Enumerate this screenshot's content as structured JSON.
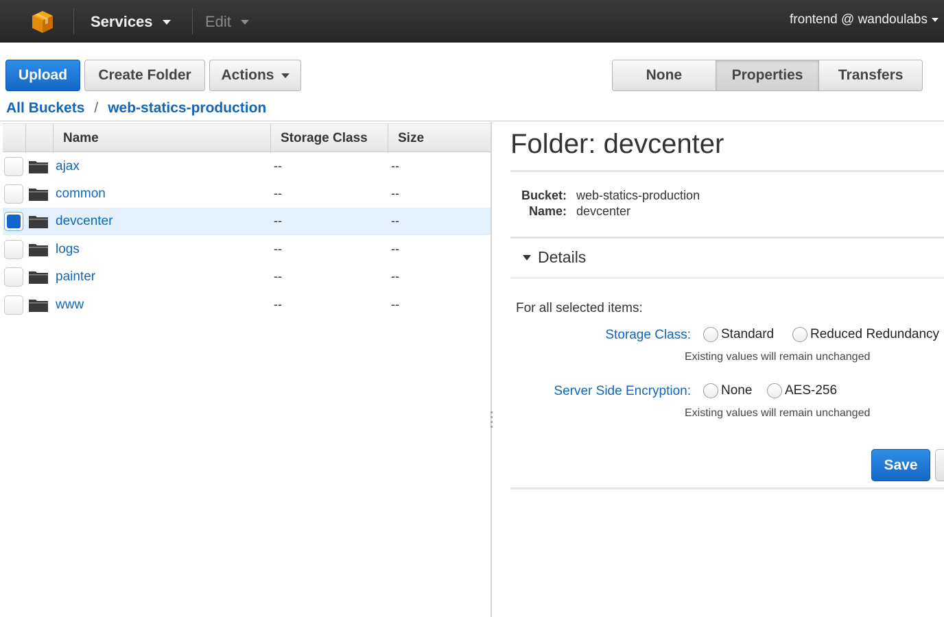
{
  "topbar": {
    "services_label": "Services",
    "edit_label": "Edit",
    "account_label": "frontend @ wandoulabs"
  },
  "toolbar": {
    "upload_label": "Upload",
    "create_folder_label": "Create Folder",
    "actions_label": "Actions",
    "view_tabs": [
      {
        "label": "None"
      },
      {
        "label": "Properties",
        "active": true
      },
      {
        "label": "Transfers"
      }
    ]
  },
  "breadcrumb": {
    "root": "All Buckets",
    "separator": "/",
    "bucket": "web-statics-production"
  },
  "table": {
    "columns": [
      "Name",
      "Storage Class",
      "Size"
    ],
    "rows": [
      {
        "name": "ajax",
        "storage_class": "--",
        "size": "--",
        "selected": false
      },
      {
        "name": "common",
        "storage_class": "--",
        "size": "--",
        "selected": false
      },
      {
        "name": "devcenter",
        "storage_class": "--",
        "size": "--",
        "selected": true
      },
      {
        "name": "logs",
        "storage_class": "--",
        "size": "--",
        "selected": false
      },
      {
        "name": "painter",
        "storage_class": "--",
        "size": "--",
        "selected": false
      },
      {
        "name": "www",
        "storage_class": "--",
        "size": "--",
        "selected": false
      }
    ]
  },
  "properties": {
    "title": "Folder: devcenter",
    "bucket_key": "Bucket:",
    "bucket_value": "web-statics-production",
    "name_key": "Name:",
    "name_value": "devcenter",
    "details_label": "Details",
    "for_all_label": "For all selected items:",
    "storage_class_label": "Storage Class:",
    "storage_options": [
      "Standard",
      "Reduced Redundancy"
    ],
    "encryption_label": "Server Side Encryption:",
    "encryption_options": [
      "None",
      "AES-256"
    ],
    "unchanged_note": "Existing values will remain unchanged",
    "save_label": "Save"
  },
  "colors": {
    "link": "#1166bb",
    "primary": "#1467c4",
    "topbar": "#2e2e2e",
    "selected_row": "#e4f0fc"
  }
}
